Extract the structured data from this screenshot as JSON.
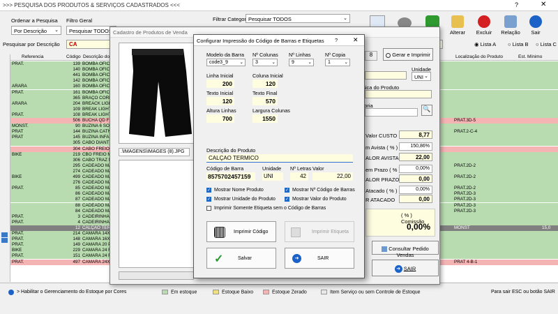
{
  "window": {
    "title": ">>>  PESQUISA DOS PRODUTOS & SERVIÇOS CADASTRADOS  <<<",
    "help": "?",
    "close": "✕"
  },
  "filters": {
    "order_label": "Ordenar a Pesquisa",
    "order_value": "Por Descrição",
    "general_label": "Filtro Geral",
    "general_value": "Pesquisar TODOS",
    "category_label": "Filtrar Categoria",
    "category_value": "Pesquisar TODOS",
    "search_label": "Pesquisar por Descrição",
    "search_value": "CA"
  },
  "toolbar": {
    "alterar": "Alterar",
    "excluir": "Excluir",
    "relacao": "Relação",
    "sair": "Sair",
    "lista_a": "Lista A",
    "lista_b": "Lista B",
    "lista_c": "Lista C"
  },
  "table": {
    "headers": [
      "Referencia",
      "Código",
      "Descrição do P",
      "Localização do Produto",
      "Est. Mínimo"
    ],
    "rows": [
      {
        "ref": "PRAT.",
        "code": "139",
        "desc": "BOMBA OFICIN",
        "loc": "",
        "cls": "g"
      },
      {
        "ref": "",
        "code": "140",
        "desc": "BOMBA OFICIN",
        "loc": "",
        "cls": "g"
      },
      {
        "ref": "",
        "code": "441",
        "desc": "BOMBA OFICIN",
        "loc": "",
        "cls": "g"
      },
      {
        "ref": "",
        "code": "142",
        "desc": "BOMBA OFICIN",
        "loc": "",
        "cls": "g"
      },
      {
        "ref": "ARARA",
        "code": "160",
        "desc": "BOMBA OFICIN",
        "loc": "",
        "cls": "g"
      },
      {
        "ref": "PRAT.",
        "code": "161",
        "desc": "BOMBA OFICIN",
        "loc": "",
        "cls": "g"
      },
      {
        "ref": "",
        "code": "365",
        "desc": "BRAÇO CORRA",
        "loc": "",
        "cls": "g"
      },
      {
        "ref": "ARARA",
        "code": "204",
        "desc": "BREACK LIGHT",
        "loc": "",
        "cls": "g"
      },
      {
        "ref": "",
        "code": "109",
        "desc": "BREAK LIGHT",
        "loc": "",
        "cls": "g"
      },
      {
        "ref": "PRAT.",
        "code": "108",
        "desc": "BREAK LIGHT",
        "loc": "",
        "cls": "g"
      },
      {
        "ref": "",
        "code": "506",
        "desc": "BUCHA QD FU",
        "loc": "PRAT.3D-5",
        "cls": "p"
      },
      {
        "ref": "MONST.",
        "code": "90",
        "desc": "BUZINA 6 SON",
        "loc": "",
        "cls": "g"
      },
      {
        "ref": "PRAT",
        "code": "144",
        "desc": "BUZINA CATN",
        "loc": "PRAT.2-C-4",
        "cls": "g"
      },
      {
        "ref": "PRAT",
        "code": "145",
        "desc": "BUZINA INFAN",
        "loc": "",
        "cls": "g"
      },
      {
        "ref": "",
        "code": "305",
        "desc": "CABO DIANT N",
        "loc": "",
        "cls": "g"
      },
      {
        "ref": "",
        "code": "304",
        "desc": "CABO FREIO D",
        "loc": "",
        "cls": "p"
      },
      {
        "ref": "BIKE",
        "code": "219",
        "desc": "CBO FREIO M",
        "loc": "",
        "cls": "g"
      },
      {
        "ref": "",
        "code": "306",
        "desc": "CABO TRAZ N",
        "loc": "",
        "cls": "g"
      },
      {
        "ref": "",
        "code": "295",
        "desc": "CADEADO MAX",
        "loc": "PRAT.2D-2",
        "cls": "g"
      },
      {
        "ref": "",
        "code": "274",
        "desc": "CADEADO MAX",
        "loc": "",
        "cls": "g"
      },
      {
        "ref": "BIKE",
        "code": "499",
        "desc": "CADEADO MAX",
        "loc": "PRAT.2D-2",
        "cls": "g"
      },
      {
        "ref": "",
        "code": "276",
        "desc": "CADEADO MAX",
        "loc": "",
        "cls": "g"
      },
      {
        "ref": "PRAT.",
        "code": "85",
        "desc": "CADEADO MAX",
        "loc": "PRAT.2D-2",
        "cls": "g"
      },
      {
        "ref": "",
        "code": "86",
        "desc": "CADEADO MAX",
        "loc": "PRAT.2D-3",
        "cls": "g"
      },
      {
        "ref": "",
        "code": "87",
        "desc": "CADEADO MAX",
        "loc": "PRAT.2D-3",
        "cls": "g"
      },
      {
        "ref": "",
        "code": "88",
        "desc": "CADEADO MAX",
        "loc": "PRAT.2D-3",
        "cls": "g"
      },
      {
        "ref": "",
        "code": "84",
        "desc": "CADEADO MAX",
        "loc": "PRAT.2D-3",
        "cls": "g"
      },
      {
        "ref": "PRAT.",
        "code": "3",
        "desc": "CADEIRINHA B",
        "loc": "",
        "cls": "g"
      },
      {
        "ref": "PRAT.",
        "code": "4",
        "desc": "CADEIRINHA D",
        "loc": "",
        "cls": "g"
      },
      {
        "ref": "",
        "code": "12",
        "desc": "CALÇAO TERM",
        "loc": "MONST",
        "cls": "s"
      },
      {
        "ref": "PRAT.",
        "code": "214",
        "desc": "CAMARA 14X1",
        "loc": "",
        "cls": "g"
      },
      {
        "ref": "PRAT.",
        "code": "148",
        "desc": "CAMARA 16X1",
        "loc": "",
        "cls": "g"
      },
      {
        "ref": "PRAT.",
        "code": "149",
        "desc": "CAMARA 20 P",
        "loc": "",
        "cls": "g"
      },
      {
        "ref": "BIKE",
        "code": "229",
        "desc": "CAMARA 24 FF",
        "loc": "",
        "cls": "g"
      },
      {
        "ref": "PRAT.",
        "code": "151",
        "desc": "CAMARA 24 F",
        "loc": "",
        "cls": "g"
      },
      {
        "ref": "PRAT.",
        "code": "497",
        "desc": "CAMARA 24X1",
        "loc": "PRAT 4-B-1",
        "cls": "p"
      }
    ],
    "selected_min": "15,0"
  },
  "status": {
    "hint": "> Habilitar o Gerenciamento do Estoque por Cores",
    "legend_em_estoque": "Em estoque",
    "legend_baixo": "Estoque Baixo",
    "legend_zerado": "Estoque Zerado",
    "legend_servico": "Item Serviço ou sem Controle de Estoque",
    "exit_hint": "Para sair ESC ou botão SAIR",
    "colors": {
      "green": "#b8dcb0",
      "yellow": "#f0e080",
      "red": "#f4b4b4",
      "gray": "#e8e8e8"
    }
  },
  "product": {
    "title": "Cadastro de Produtos de Venda",
    "image_path": ".\\IMAGENS\\IMAGES (8).JPG",
    "gerar_btn": "Gerar e Imprimir",
    "unidade_label": "Unidade",
    "unidade_value": "UNI",
    "fisica_label": "ísica do Produto",
    "categoria_label": "goria",
    "valor_custo_label": "Valor CUSTO",
    "valor_custo": "8,77",
    "avista_pct_label": "m Avista ( % )",
    "avista_pct": "150,86%",
    "valor_avista_label": "ALOR AVISTA",
    "valor_avista": "22,00",
    "prazo_pct_label": "em Prazo ( % )",
    "prazo_pct": "0,00%",
    "valor_prazo_label": "ALOR PRAZO",
    "valor_prazo": "0,00",
    "atacado_pct_label": "Atacado ( % )",
    "atacado_pct": "0,00%",
    "valor_atacado_label": "R ATACADO",
    "valor_atacado": "0,00",
    "comissao_label": "( % ) Comissão",
    "comissao": "0,00%",
    "consultar_btn": "Consultar Pedido Vendas",
    "sair_btn": "SAIR"
  },
  "dialog": {
    "title": "Configurar Impressão do Código de Barras e Etiquetas",
    "help": "?",
    "close": "✕",
    "modelo_label": "Modelo da Barra",
    "modelo_value": "code3_9",
    "ncolunas_label": "Nº Colunas",
    "ncolunas_value": "3",
    "nlinhas_label": "Nº Linhas",
    "nlinhas_value": "9",
    "ncopia_label": "Nº Copia",
    "ncopia_value": "1",
    "linha_inicial_label": "Linha Inicial",
    "linha_inicial": "200",
    "coluna_inicial_label": "Coluna Inicial",
    "coluna_inicial": "120",
    "texto_inicial_label": "Texto Inicial",
    "texto_inicial": "120",
    "texto_final_label": "Texto Final",
    "texto_final": "570",
    "altura_label": "Altura Linhas",
    "altura": "700",
    "largura_label": "Largura Colunas",
    "largura": "1550",
    "descricao_label": "Descrição do Produto",
    "descricao_value": "CALÇAO TERMICO",
    "codbarra_label": "Código de Barra",
    "codbarra_value": "8575702457159",
    "unidade_label": "Unidade",
    "unidade_value": "UNI",
    "nletras_label": "Nº Letras",
    "nletras_value": "42",
    "valor_label": "Valor",
    "valor_value": "22,00",
    "chk_nome": "Mostrar Nome Produto",
    "chk_ncodigo": "Mostrar Nº Código de Barras",
    "chk_unidade": "Mostrar Unidade do Produto",
    "chk_valor": "Mostrar Valor do Produto",
    "chk_somente": "Imprimir Somente Etiqueta sem o Código de Barras",
    "imprimir_codigo": "Imprimir Código",
    "imprimir_etiqueta": "Imprimir Etiqueta",
    "salvar": "Salvar",
    "sair": "SAIR"
  }
}
